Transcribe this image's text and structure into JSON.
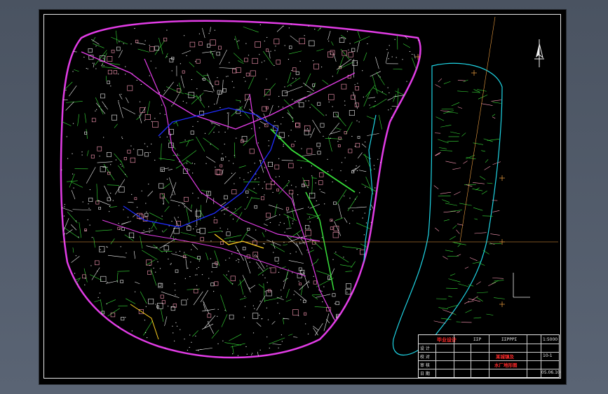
{
  "colors": {
    "background": "#4d5664",
    "sheet": "#000000",
    "contour_green": "#38e03a",
    "parcel_white": "#f2f2f2",
    "road_magenta": "#e23ce6",
    "building_pink": "#ff9bb8",
    "water_cyan": "#1fd6e6",
    "stream_blue": "#1f2cff",
    "road_yellow": "#ffd21f",
    "gridline_orange": "#f0a040",
    "title_red": "#ff2a2a"
  },
  "title_block": {
    "heading": "毕业设计",
    "drawing_no": "ΣΣΡΡΡΣ",
    "scale": "1:5000",
    "sheet": "10-1",
    "date": "05.06.10",
    "project_line1": "某城镇及",
    "project_line2": "水厂地形图",
    "labels_left": [
      "设 计",
      "校 对",
      "审 核",
      "日 期"
    ],
    "small_code": "ΣΣΡ"
  },
  "map": {
    "north_arrow": "north-arrow-icon",
    "axis_icon": "xy-axis-icon"
  }
}
